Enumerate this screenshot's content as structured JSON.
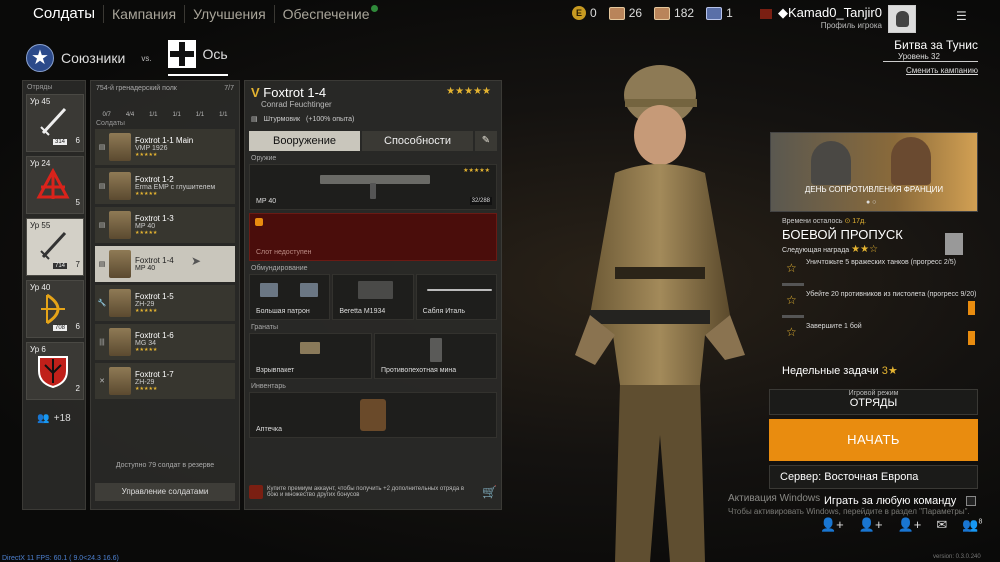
{
  "nav": {
    "tabs": [
      "Солдаты",
      "Кампания",
      "Улучшения",
      "Обеспечение"
    ]
  },
  "currencies": {
    "gold": "0",
    "cards1": "26",
    "cards2": "182",
    "cards3": "1"
  },
  "user": {
    "name": "Kamad0_Tanjir0",
    "profile_label": "Профиль игрока"
  },
  "factions": {
    "allies": "Союзники",
    "vs": "vs.",
    "axis": "Ось"
  },
  "squads": {
    "title": "Отряды",
    "items": [
      {
        "level": "Ур 45",
        "num": "314",
        "count": "6"
      },
      {
        "level": "Ур 24",
        "num": "",
        "count": "5"
      },
      {
        "level": "Ур 55",
        "num": "714",
        "count": "7"
      },
      {
        "level": "Ур 40",
        "num": "708",
        "count": "6"
      },
      {
        "level": "Ур 6",
        "num": "",
        "count": "2"
      }
    ],
    "more": "+18"
  },
  "squad_panel": {
    "regiment": "754-й гренадерский полк",
    "capacity": "7/7",
    "stats": [
      "0/7",
      "4/4",
      "1/1",
      "1/1",
      "1/1",
      "1/1"
    ],
    "soldiers_title": "Солдаты",
    "soldiers": [
      {
        "name": "Foxtrot 1-1 Main",
        "weapon": "VMP 1926"
      },
      {
        "name": "Foxtrot 1-2",
        "weapon": "Erma EMP с глушителем"
      },
      {
        "name": "Foxtrot 1-3",
        "weapon": "MP 40"
      },
      {
        "name": "Foxtrot 1-4",
        "weapon": "MP 40"
      },
      {
        "name": "Foxtrot 1-5",
        "weapon": "ZH-29"
      },
      {
        "name": "Foxtrot 1-6",
        "weapon": "MG 34"
      },
      {
        "name": "Foxtrot 1-7",
        "weapon": "ZH-29"
      }
    ],
    "reserve": "Доступно 79 солдат в резерве",
    "manage": "Управление солдатами"
  },
  "soldier": {
    "rank": "V",
    "name": "Foxtrot 1-4",
    "fullname": "Conrad Feuchtinger",
    "class": "Штурмовик",
    "xp_bonus": "(+100% опыта)",
    "tabs": [
      "Вооружение",
      "Способности"
    ],
    "sections": {
      "weapon": "Оружие",
      "equipment": "Обмундирование",
      "grenades": "Гранаты",
      "inventory": "Инвентарь"
    },
    "primary": {
      "name": "MP 40",
      "ammo": "32/288"
    },
    "locked_slot": "Слот недоступен",
    "equipment": [
      "Большая патрон",
      "Beretta M1934",
      "Сабля Италь"
    ],
    "grenades": [
      "Взрывпакет",
      "Противопехотная мина"
    ],
    "inventory": [
      "Аптечка"
    ],
    "promo": "Купите премиум аккаунт, чтобы получить +2 дополнительных отряда в бою и множество других бонусов"
  },
  "campaign": {
    "battle": "Битва за Тунис",
    "level": "Уровень 32",
    "change": "Сменить кампанию"
  },
  "event": {
    "title": "ДЕНЬ СОПРОТИВЛЕНИЯ ФРАНЦИИ"
  },
  "battle_pass": {
    "time_label": "Времени осталось",
    "time_value": "17д.",
    "title": "БОЕВОЙ ПРОПУСК",
    "next_reward": "Следующая награда",
    "tasks": [
      "Уничтожьте 5 вражеских танков (прогресс 2/5)",
      "Убейте 20 противников из пистолета (прогресс 9/20)",
      "Завершите 1 бой"
    ]
  },
  "weekly": {
    "label": "Недельные задачи",
    "count": "3"
  },
  "mode": {
    "label": "Игровой режим",
    "value": "ОТРЯДЫ"
  },
  "start_button": "НАЧАТЬ",
  "server": "Сервер: Восточная Европа",
  "any_team": "Играть за любую команду",
  "windows": {
    "line1": "Активация Windows",
    "line2": "Чтобы активировать Windows, перейдите в раздел \"Параметры\"."
  },
  "fps": "DirectX 11 FPS: 60.1 ( 9.0<24.3 16.6)",
  "version": "version: 0.3.0.240",
  "notify_count": "8"
}
